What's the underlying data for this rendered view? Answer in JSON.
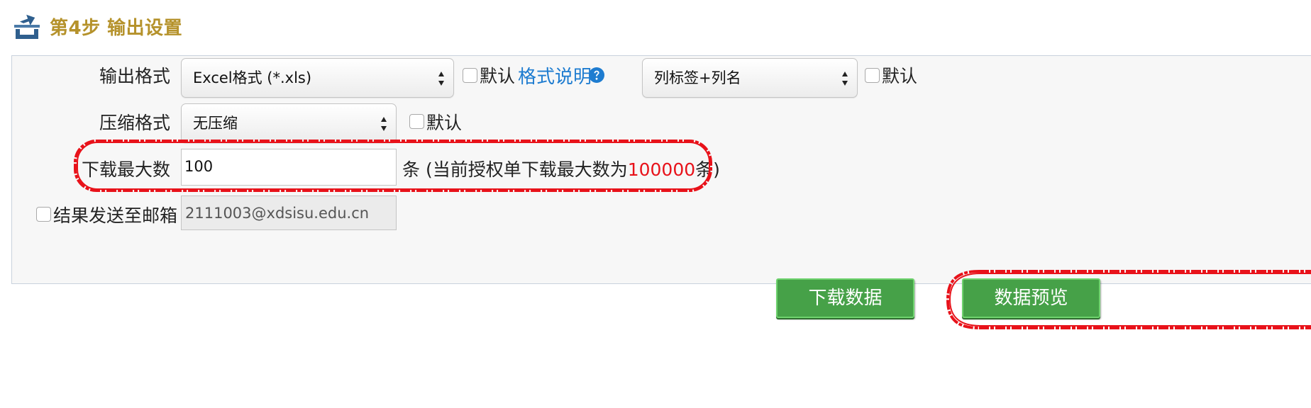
{
  "step": {
    "title": "第4步 输出设置",
    "icon": "export-icon"
  },
  "output_format": {
    "label": "输出格式",
    "selected": "Excel格式 (*.xls)",
    "default_label": "默认",
    "help_link": "格式说明",
    "help_icon": "question-circle-icon",
    "header_select": "列标签+列名",
    "header_default_label": "默认"
  },
  "compression": {
    "label": "压缩格式",
    "selected": "无压缩",
    "default_label": "默认"
  },
  "max_download": {
    "label": "下载最大数",
    "value": "100",
    "hint_prefix": "条 (当前授权单下载最大数为",
    "hint_number": "100000",
    "hint_suffix": "条)"
  },
  "email": {
    "label": "结果发送至邮箱",
    "value": "2111003@xdsisu.edu.cn"
  },
  "buttons": {
    "download": "下载数据",
    "preview": "数据预览"
  },
  "colors": {
    "title": "#b5922b",
    "link": "#1e7cd0",
    "highlight_number": "#e8121a",
    "button_green": "#46a148",
    "annotation_red": "#e8121a"
  }
}
